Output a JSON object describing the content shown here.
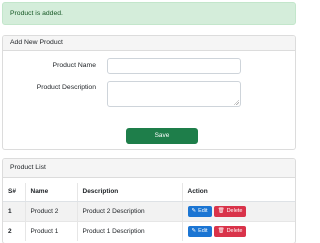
{
  "alert": {
    "message": "Product is added."
  },
  "add_form": {
    "header": "Add New Product",
    "name_label": "Product Name",
    "name_value": "",
    "description_label": "Product Description",
    "description_value": "",
    "save_label": "Save"
  },
  "product_list": {
    "header": "Product List",
    "columns": [
      "S#",
      "Name",
      "Description",
      "Action"
    ],
    "rows": [
      {
        "sn": "1",
        "name": "Product 2",
        "description": "Product 2 Description"
      },
      {
        "sn": "2",
        "name": "Product 1",
        "description": "Product 1 Description"
      }
    ],
    "edit_label": "Edit",
    "delete_label": "Delete"
  },
  "colors": {
    "alert_bg": "#d4edda",
    "save_button": "#1e7e4a",
    "edit_button": "#1b75d3",
    "delete_button": "#d9334a"
  },
  "icons": {
    "edit": "edit-icon",
    "delete": "trash-icon"
  }
}
